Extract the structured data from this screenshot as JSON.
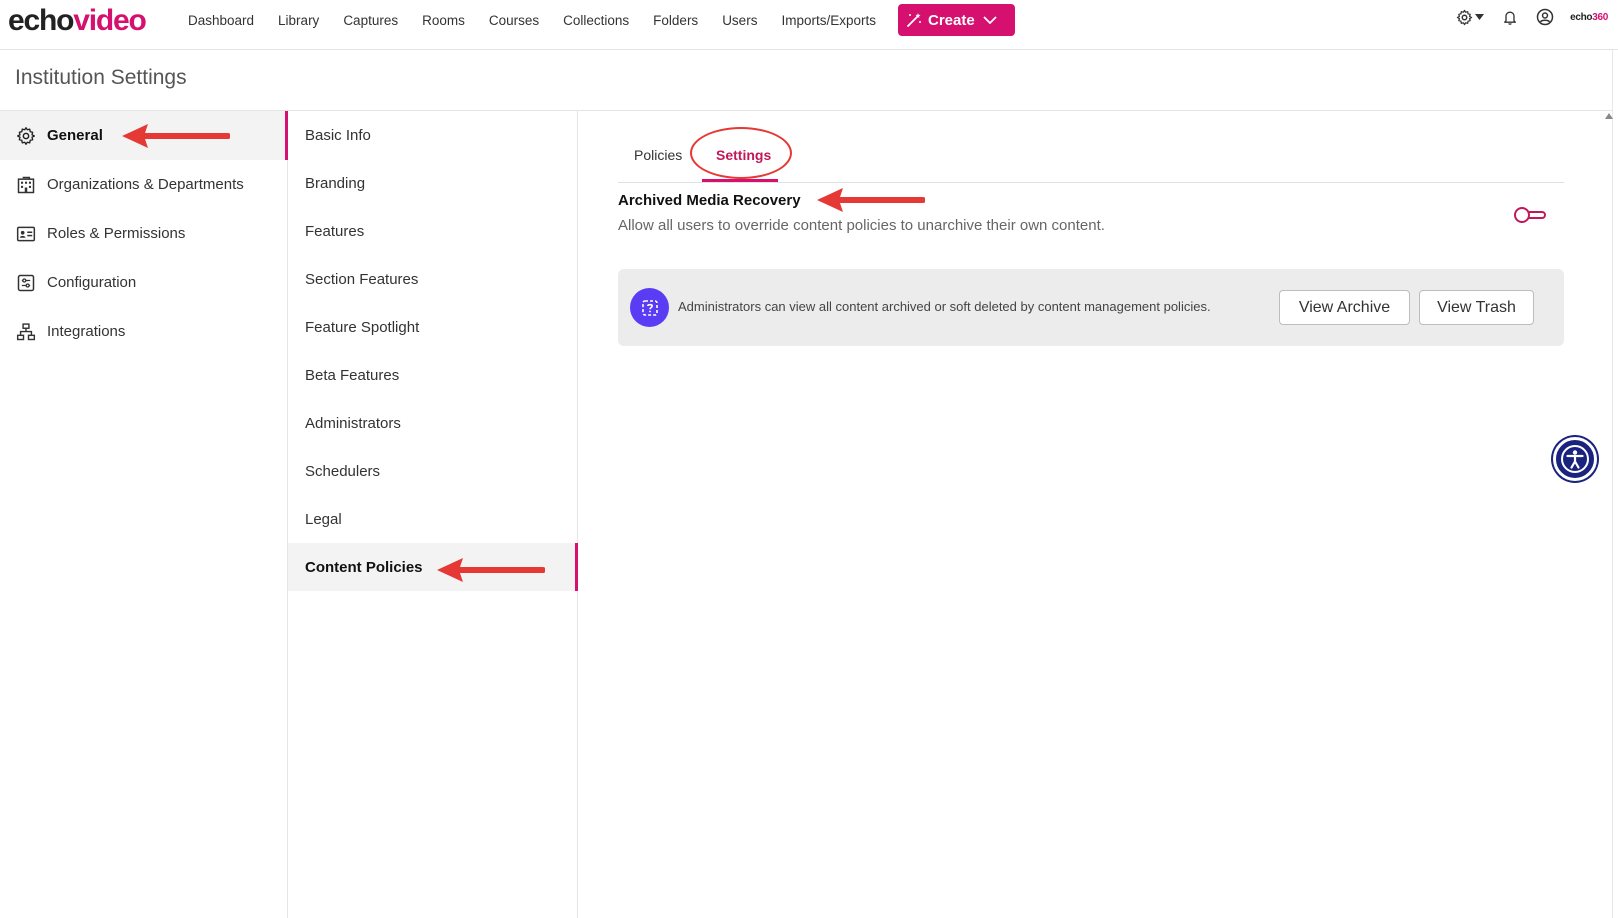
{
  "brand": {
    "logo_part1": "echo",
    "logo_part2": "video",
    "corner_brand_part1": "echo",
    "corner_brand_part2": "360",
    "accent_color": "#d6106e"
  },
  "nav": {
    "items": [
      "Dashboard",
      "Library",
      "Captures",
      "Rooms",
      "Courses",
      "Collections",
      "Folders",
      "Users",
      "Imports/Exports"
    ],
    "create_label": "Create",
    "icons": [
      "gear-icon",
      "bell-icon",
      "user-circle-icon"
    ]
  },
  "page": {
    "title": "Institution Settings"
  },
  "sidebar": {
    "items": [
      {
        "label": "General",
        "icon": "gear-icon",
        "active": true
      },
      {
        "label": "Organizations & Departments",
        "icon": "building-icon",
        "active": false
      },
      {
        "label": "Roles & Permissions",
        "icon": "id-card-icon",
        "active": false
      },
      {
        "label": "Configuration",
        "icon": "sliders-icon",
        "active": false
      },
      {
        "label": "Integrations",
        "icon": "network-icon",
        "active": false
      }
    ]
  },
  "subnav": {
    "items": [
      {
        "label": "Basic Info",
        "active": false
      },
      {
        "label": "Branding",
        "active": false
      },
      {
        "label": "Features",
        "active": false
      },
      {
        "label": "Section Features",
        "active": false
      },
      {
        "label": "Feature Spotlight",
        "active": false
      },
      {
        "label": "Beta Features",
        "active": false
      },
      {
        "label": "Administrators",
        "active": false
      },
      {
        "label": "Schedulers",
        "active": false
      },
      {
        "label": "Legal",
        "active": false
      },
      {
        "label": "Content Policies",
        "active": true
      }
    ]
  },
  "main": {
    "tabs": [
      {
        "label": "Policies",
        "active": false
      },
      {
        "label": "Settings",
        "active": true
      }
    ],
    "setting": {
      "title": "Archived Media Recovery",
      "description": "Allow all users to override content policies to unarchive their own content.",
      "enabled": false
    },
    "info": {
      "text": "Administrators can view all content archived or soft deleted by content management policies.",
      "view_archive_label": "View Archive",
      "view_trash_label": "View Trash"
    }
  },
  "annotation_color": "#e53935"
}
